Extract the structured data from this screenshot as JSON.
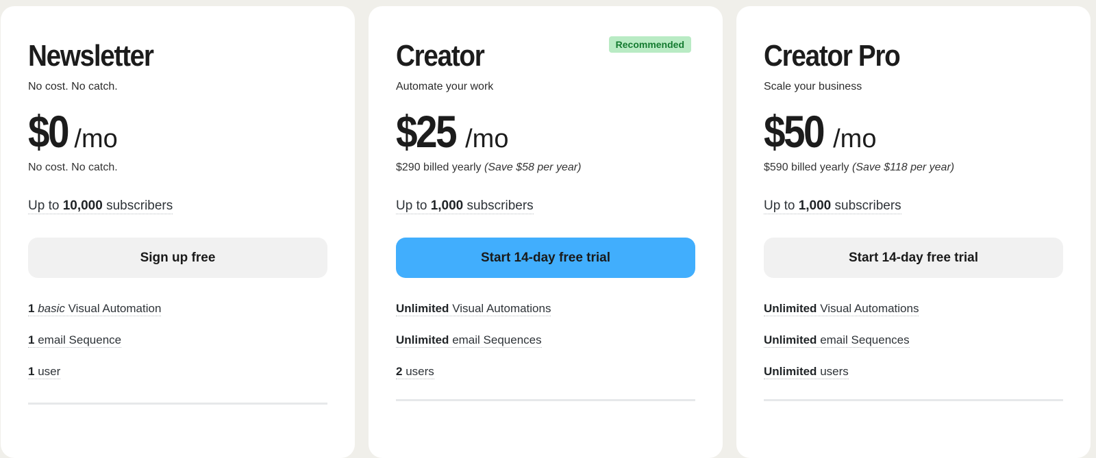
{
  "plans": [
    {
      "name": "Newsletter",
      "tagline": "No cost. No catch.",
      "badge": null,
      "price": "$0",
      "period": "/mo",
      "billing": "No cost. No catch.",
      "billing_save": "",
      "subscribers_prefix": "Up to",
      "subscribers_count": "10,000",
      "subscribers_suffix": "subscribers",
      "cta_label": "Sign up free",
      "cta_style": "secondary",
      "features": [
        {
          "bold": "1",
          "italic": "basic",
          "text": "Visual Automation"
        },
        {
          "bold": "1",
          "italic": "",
          "text": "email Sequence"
        },
        {
          "bold": "1",
          "italic": "",
          "text": "user"
        }
      ]
    },
    {
      "name": "Creator",
      "tagline": "Automate your work",
      "badge": "Recommended",
      "price": "$25",
      "period": "/mo",
      "billing": "$290 billed yearly",
      "billing_save": "(Save $58 per year)",
      "subscribers_prefix": "Up to",
      "subscribers_count": "1,000",
      "subscribers_suffix": "subscribers",
      "cta_label": "Start 14-day free trial",
      "cta_style": "primary",
      "features": [
        {
          "bold": "Unlimited",
          "italic": "",
          "text": "Visual Automations"
        },
        {
          "bold": "Unlimited",
          "italic": "",
          "text": "email Sequences"
        },
        {
          "bold": "2",
          "italic": "",
          "text": "users"
        }
      ]
    },
    {
      "name": "Creator Pro",
      "tagline": "Scale your business",
      "badge": null,
      "price": "$50",
      "period": "/mo",
      "billing": "$590 billed yearly",
      "billing_save": "(Save $118 per year)",
      "subscribers_prefix": "Up to",
      "subscribers_count": "1,000",
      "subscribers_suffix": "subscribers",
      "cta_label": "Start 14-day free trial",
      "cta_style": "secondary",
      "features": [
        {
          "bold": "Unlimited",
          "italic": "",
          "text": "Visual Automations"
        },
        {
          "bold": "Unlimited",
          "italic": "",
          "text": "email Sequences"
        },
        {
          "bold": "Unlimited",
          "italic": "",
          "text": "users"
        }
      ]
    }
  ],
  "colors": {
    "page_background": "#f0efea",
    "card_background": "#ffffff",
    "primary_button": "#41aefd",
    "secondary_button": "#f1f1f1",
    "badge_background": "#b9ebc4",
    "badge_text": "#137a2f"
  }
}
